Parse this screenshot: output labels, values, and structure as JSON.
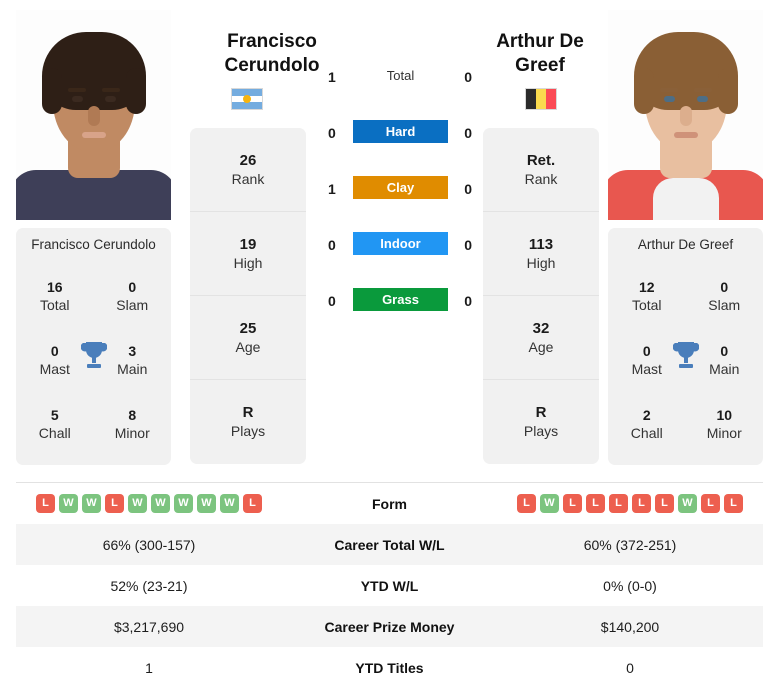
{
  "players": {
    "left": {
      "name_line1": "Francisco",
      "name_line2": "Cerundolo",
      "full_name": "Francisco Cerundolo",
      "country_flag": "argentina-flag",
      "rank": "26",
      "rank_label": "Rank",
      "high": "19",
      "high_label": "High",
      "age": "25",
      "age_label": "Age",
      "plays": "R",
      "plays_label": "Plays",
      "titles": {
        "total": "16",
        "total_label": "Total",
        "slam": "0",
        "slam_label": "Slam",
        "mast": "0",
        "mast_label": "Mast",
        "main": "3",
        "main_label": "Main",
        "chall": "5",
        "chall_label": "Chall",
        "minor": "8",
        "minor_label": "Minor"
      },
      "form": [
        "L",
        "W",
        "W",
        "L",
        "W",
        "W",
        "W",
        "W",
        "W",
        "L"
      ],
      "career_wl": "66% (300-157)",
      "ytd_wl": "52% (23-21)",
      "prize_money": "$3,217,690",
      "ytd_titles": "1"
    },
    "right": {
      "name_line1": "Arthur De",
      "name_line2": "Greef",
      "full_name": "Arthur De Greef",
      "country_flag": "belgium-flag",
      "rank": "Ret.",
      "rank_label": "Rank",
      "high": "113",
      "high_label": "High",
      "age": "32",
      "age_label": "Age",
      "plays": "R",
      "plays_label": "Plays",
      "titles": {
        "total": "12",
        "total_label": "Total",
        "slam": "0",
        "slam_label": "Slam",
        "mast": "0",
        "mast_label": "Mast",
        "main": "0",
        "main_label": "Main",
        "chall": "2",
        "chall_label": "Chall",
        "minor": "10",
        "minor_label": "Minor"
      },
      "form": [
        "L",
        "W",
        "L",
        "L",
        "L",
        "L",
        "L",
        "W",
        "L",
        "L"
      ],
      "career_wl": "60% (372-251)",
      "ytd_wl": "0% (0-0)",
      "prize_money": "$140,200",
      "ytd_titles": "0"
    }
  },
  "h2h_surfaces": [
    {
      "label": "Total",
      "left": "1",
      "right": "0",
      "color": "",
      "style": "plain"
    },
    {
      "label": "Hard",
      "left": "0",
      "right": "0",
      "color": "#0a6fc2",
      "style": "badge"
    },
    {
      "label": "Clay",
      "left": "1",
      "right": "0",
      "color": "#e08c00",
      "style": "badge"
    },
    {
      "label": "Indoor",
      "left": "0",
      "right": "0",
      "color": "#2196f3",
      "style": "badge"
    },
    {
      "label": "Grass",
      "left": "0",
      "right": "0",
      "color": "#0a9a3c",
      "style": "badge"
    }
  ],
  "stat_rows": [
    {
      "label": "Form",
      "key": "form",
      "type": "form"
    },
    {
      "label": "Career Total W/L",
      "key": "career_wl",
      "type": "text"
    },
    {
      "label": "YTD W/L",
      "key": "ytd_wl",
      "type": "text"
    },
    {
      "label": "Career Prize Money",
      "key": "prize_money",
      "type": "text"
    },
    {
      "label": "YTD Titles",
      "key": "ytd_titles",
      "type": "text"
    }
  ],
  "colors": {
    "win": "#7cc47f",
    "loss": "#ed5f4f",
    "trophy": "#4a7ebb",
    "card_bg": "#f1f1f1",
    "row_shade": "#f4f4f4"
  }
}
